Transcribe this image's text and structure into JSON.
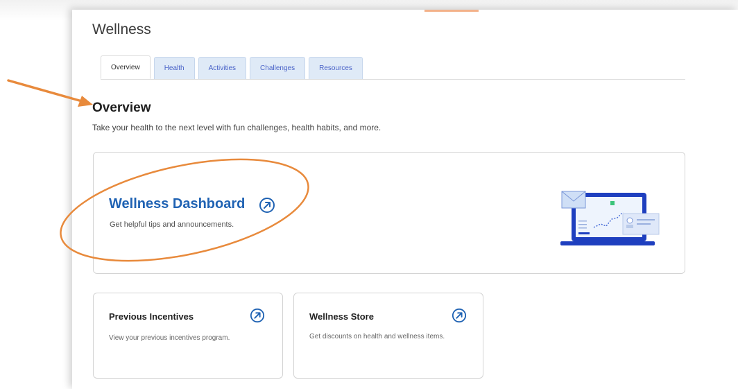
{
  "page": {
    "title": "Wellness"
  },
  "tabs": [
    {
      "label": "Overview",
      "active": true
    },
    {
      "label": "Health",
      "active": false
    },
    {
      "label": "Activities",
      "active": false
    },
    {
      "label": "Challenges",
      "active": false
    },
    {
      "label": "Resources",
      "active": false
    }
  ],
  "overview": {
    "title": "Overview",
    "description": "Take your health to the next level with fun challenges, health habits, and more."
  },
  "cards": {
    "dashboard": {
      "title": "Wellness Dashboard",
      "description": "Get helpful tips and announcements.",
      "icon": "external-link-circle-icon"
    },
    "incentives": {
      "title": "Previous Incentives",
      "description": "View your previous incentives program.",
      "icon": "external-link-circle-icon"
    },
    "store": {
      "title": "Wellness Store",
      "description": "Get discounts on health and wellness items.",
      "icon": "external-link-circle-icon"
    }
  },
  "annotations": {
    "color": "#e88a3c",
    "shapes": [
      "arrow",
      "ellipse"
    ]
  },
  "colors": {
    "link_blue": "#1f62b3",
    "tab_blue": "#4a63c8",
    "tab_bg": "#dfeaf7"
  }
}
